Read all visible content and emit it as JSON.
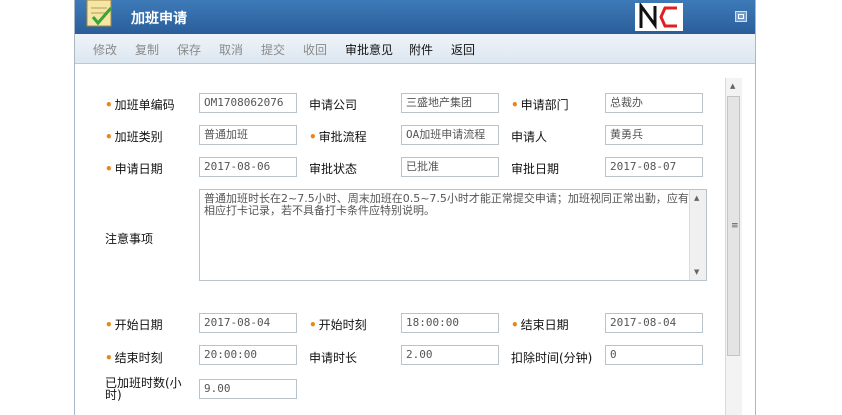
{
  "window": {
    "title": "加班申请"
  },
  "toolbar": {
    "items": [
      "修改",
      "复制",
      "保存",
      "取消",
      "提交",
      "收回",
      "审批意见",
      "附件",
      "返回"
    ]
  },
  "form": {
    "overtime_no_label": "加班单编码",
    "overtime_no_value": "OM1708062076",
    "company_label": "申请公司",
    "company_value": "三盛地产集团",
    "dept_label": "申请部门",
    "dept_value": "总裁办",
    "type_label": "加班类别",
    "type_value": "普通加班",
    "flow_label": "审批流程",
    "flow_value": "OA加班申请流程",
    "applicant_label": "申请人",
    "applicant_value": "黄勇兵",
    "apply_date_label": "申请日期",
    "apply_date_value": "2017-08-06",
    "status_label": "审批状态",
    "status_value": "已批准",
    "approve_date_label": "审批日期",
    "approve_date_value": "2017-08-07",
    "notes_label": "注意事项",
    "notes_value": "普通加班时长在2~7.5小时、周末加班在0.5~7.5小时才能正常提交申请；加班视同正常出勤，应有相应打卡记录，若不具备打卡条件应特别说明。",
    "start_date_label": "开始日期",
    "start_date_value": "2017-08-04",
    "start_time_label": "开始时刻",
    "start_time_value": "18:00:00",
    "end_date_label": "结束日期",
    "end_date_value": "2017-08-04",
    "end_time_label": "结束时刻",
    "end_time_value": "20:00:00",
    "duration_label": "申请时长",
    "duration_value": "2.00",
    "deduct_label": "扣除时间(分钟)",
    "deduct_value": "0",
    "done_hours_label": "已加班时数(小时)",
    "done_hours_value": "9.00"
  },
  "colors": {
    "titlebar": "#2f6aa8",
    "required_mark": "#e8861c",
    "logo_red": "#e02020"
  }
}
